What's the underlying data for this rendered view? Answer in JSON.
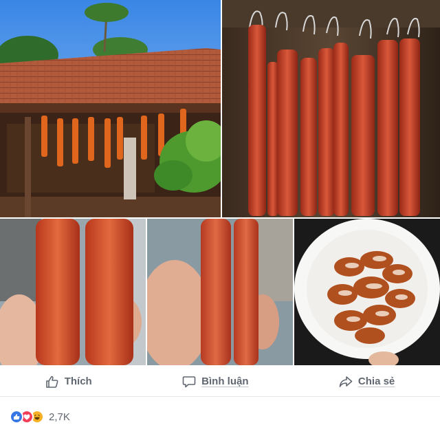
{
  "post": {
    "photos": [
      {
        "subject": "house-with-hanging-meat"
      },
      {
        "subject": "meat-strips-on-hooks"
      },
      {
        "subject": "hand-holding-two-strips"
      },
      {
        "subject": "hand-holding-two-strips-close"
      },
      {
        "subject": "plate-of-sliced-meat"
      }
    ]
  },
  "actions": {
    "like_label": "Thích",
    "comment_label": "Bình luận",
    "share_label": "Chia sẻ"
  },
  "reactions": {
    "types": [
      "like",
      "love",
      "haha"
    ],
    "count": "2,7K"
  },
  "colors": {
    "action_text": "#606770",
    "like_blue": "#3578e5",
    "love_red": "#f33e58",
    "haha_yellow": "#f7b125"
  }
}
